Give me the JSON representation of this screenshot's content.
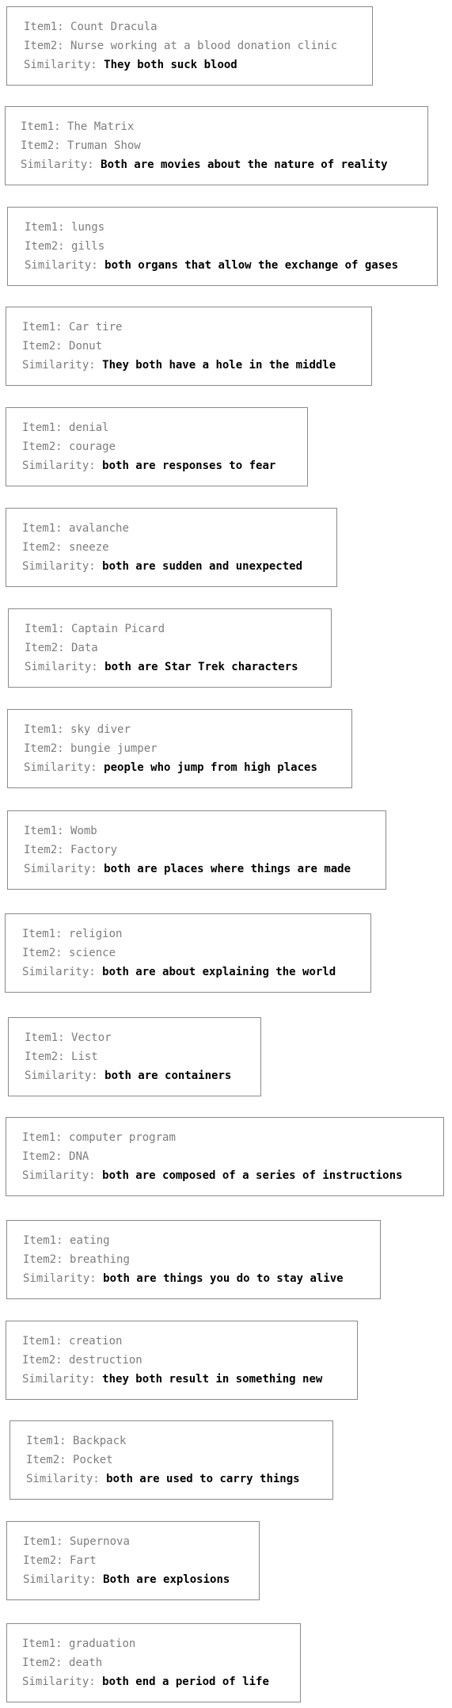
{
  "labels": {
    "item1": "Item1: ",
    "item2": "Item2: ",
    "similarity": "Similarity: "
  },
  "cards": [
    {
      "item1": "Count Dracula",
      "item2": "Nurse working at a blood donation clinic",
      "similarity": "They both suck blood"
    },
    {
      "item1": "The Matrix",
      "item2": "Truman Show",
      "similarity": "Both are movies about the nature of reality"
    },
    {
      "item1": "lungs",
      "item2": "gills",
      "similarity": "both organs that allow the exchange of gases"
    },
    {
      "item1": "Car tire",
      "item2": "Donut",
      "similarity": "They both have a hole in the middle"
    },
    {
      "item1": "denial",
      "item2": "courage",
      "similarity": "both are responses to fear"
    },
    {
      "item1": "avalanche",
      "item2": "sneeze",
      "similarity": "both are sudden and unexpected"
    },
    {
      "item1": "Captain Picard",
      "item2": "Data",
      "similarity": "both are Star Trek characters"
    },
    {
      "item1": "sky diver",
      "item2": "bungie jumper",
      "similarity": "people who jump from high places"
    },
    {
      "item1": "Womb",
      "item2": "Factory",
      "similarity": "both are places where things are made"
    },
    {
      "item1": "religion",
      "item2": "science",
      "similarity": "both are about explaining the world"
    },
    {
      "item1": "Vector",
      "item2": "List",
      "similarity": "both are containers"
    },
    {
      "item1": "computer program",
      "item2": "DNA",
      "similarity": "both are composed of a series of instructions"
    },
    {
      "item1": "eating",
      "item2": "breathing",
      "similarity": "both are things you do to stay alive"
    },
    {
      "item1": "creation",
      "item2": "destruction",
      "similarity": "they both result in something new"
    },
    {
      "item1": "Backpack",
      "item2": "Pocket",
      "similarity": "both are used to carry things"
    },
    {
      "item1": "Supernova",
      "item2": "Fart",
      "similarity": "Both are explosions"
    },
    {
      "item1": "graduation",
      "item2": "death",
      "similarity": "both end a period of life"
    }
  ]
}
